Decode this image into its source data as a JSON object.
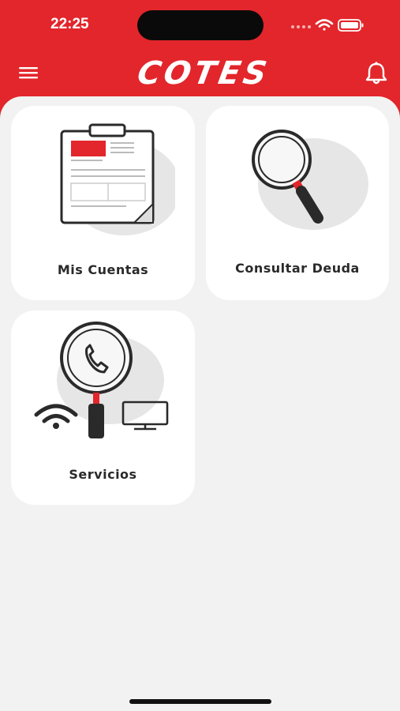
{
  "status_bar": {
    "time": "22:25"
  },
  "header": {
    "logo_text": "COTES"
  },
  "colors": {
    "brand_red": "#e2262b",
    "background": "#f2f2f2",
    "card": "#ffffff"
  },
  "cards": [
    {
      "label": "Mis Cuentas",
      "icon": "clipboard-icon"
    },
    {
      "label": "Consultar Deuda",
      "icon": "magnifier-icon"
    },
    {
      "label": "Servicios",
      "icon": "services-icon"
    }
  ]
}
